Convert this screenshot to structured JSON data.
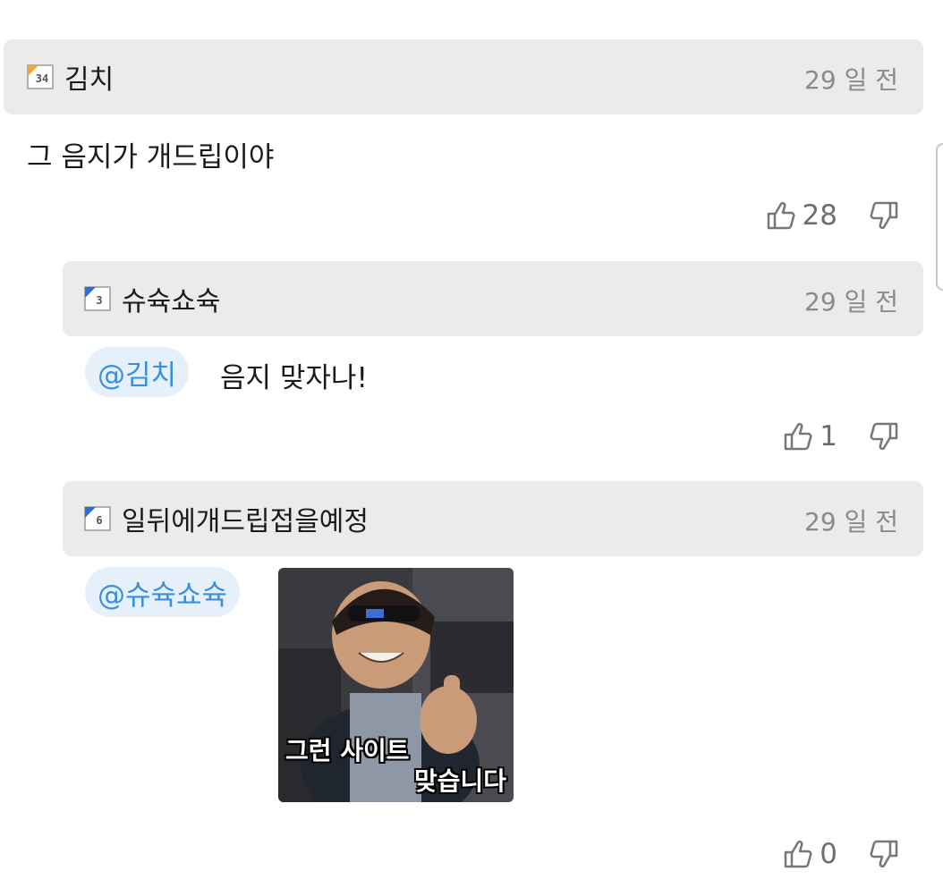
{
  "comments": [
    {
      "level": "34",
      "author": "김치",
      "time": "29 일 전",
      "text": "그 음지가 개드립이야",
      "likes": "28"
    },
    {
      "level": "3",
      "author": "슈슉쇼슉",
      "time": "29 일 전",
      "mention": "@김치",
      "text": "음지 맞자나!",
      "likes": "1"
    },
    {
      "level": "6",
      "author": "일뒤에개드립접을예정",
      "time": "29 일 전",
      "mention": "@슈슉쇼슉",
      "sticker_caption": [
        "그런 사이트",
        "맞습니다"
      ],
      "likes": "0"
    }
  ],
  "colors": {
    "header_bg": "#ebebeb",
    "mention_bg": "#e6f0fb",
    "mention_text": "#3a8fdc",
    "muted_text": "#8a8a8a",
    "level_orange": "#f5a623",
    "level_blue": "#2b6fd6"
  },
  "icons": {
    "like": "thumbs-up-icon",
    "dislike": "thumbs-down-icon"
  }
}
